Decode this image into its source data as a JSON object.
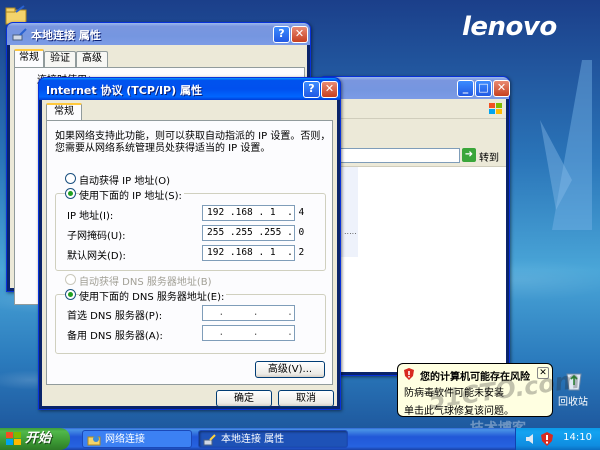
{
  "desktop": {
    "brand": "lenovo",
    "recycle_label": "回收站"
  },
  "explorer": {
    "go_label": "转到"
  },
  "props_window": {
    "title": "本地连接 属性",
    "tabs": [
      "常规",
      "验证",
      "高级"
    ],
    "connect_using": "连接时使用："
  },
  "tcpip": {
    "title": "Internet 协议 (TCP/IP) 属性",
    "tab": "常规",
    "intro_line1": "如果网络支持此功能，则可以获取自动指派的 IP 设置。否则，",
    "intro_line2": "您需要从网络系统管理员处获得适当的 IP 设置。",
    "auto_ip": "自动获得 IP 地址(O)",
    "manual_ip": "使用下面的 IP 地址(S):",
    "ip_label": "IP 地址(I):",
    "ip_value": "192 .168 . 1  . 4",
    "mask_label": "子网掩码(U):",
    "mask_value": "255 .255 .255 . 0",
    "gateway_label": "默认网关(D):",
    "gateway_value": "192 .168 . 1  . 2",
    "auto_dns": "自动获得 DNS 服务器地址(B)",
    "manual_dns": "使用下面的 DNS 服务器地址(E):",
    "pref_dns_label": "首选 DNS 服务器(P):",
    "pref_dns_value": "  .     .     .",
    "alt_dns_label": "备用 DNS 服务器(A):",
    "alt_dns_value": "  .     .     .",
    "advanced": "高级(V)...",
    "ok": "确定",
    "cancel": "取消"
  },
  "balloon": {
    "title": "您的计算机可能存在风险",
    "line1": "防病毒软件可能未安装",
    "line2": "单击此气球修复该问题。"
  },
  "watermark": {
    "text1": "51CTO.com",
    "text2": "技术博客"
  },
  "taskbar": {
    "start": "开始",
    "tasks": [
      "网络连接",
      "本地连接 属性"
    ],
    "clock": "14:10"
  },
  "colors": {
    "xp_blue": "#0053ee",
    "start_green": "#3c9a35",
    "dialog_face": "#ece9d8"
  }
}
